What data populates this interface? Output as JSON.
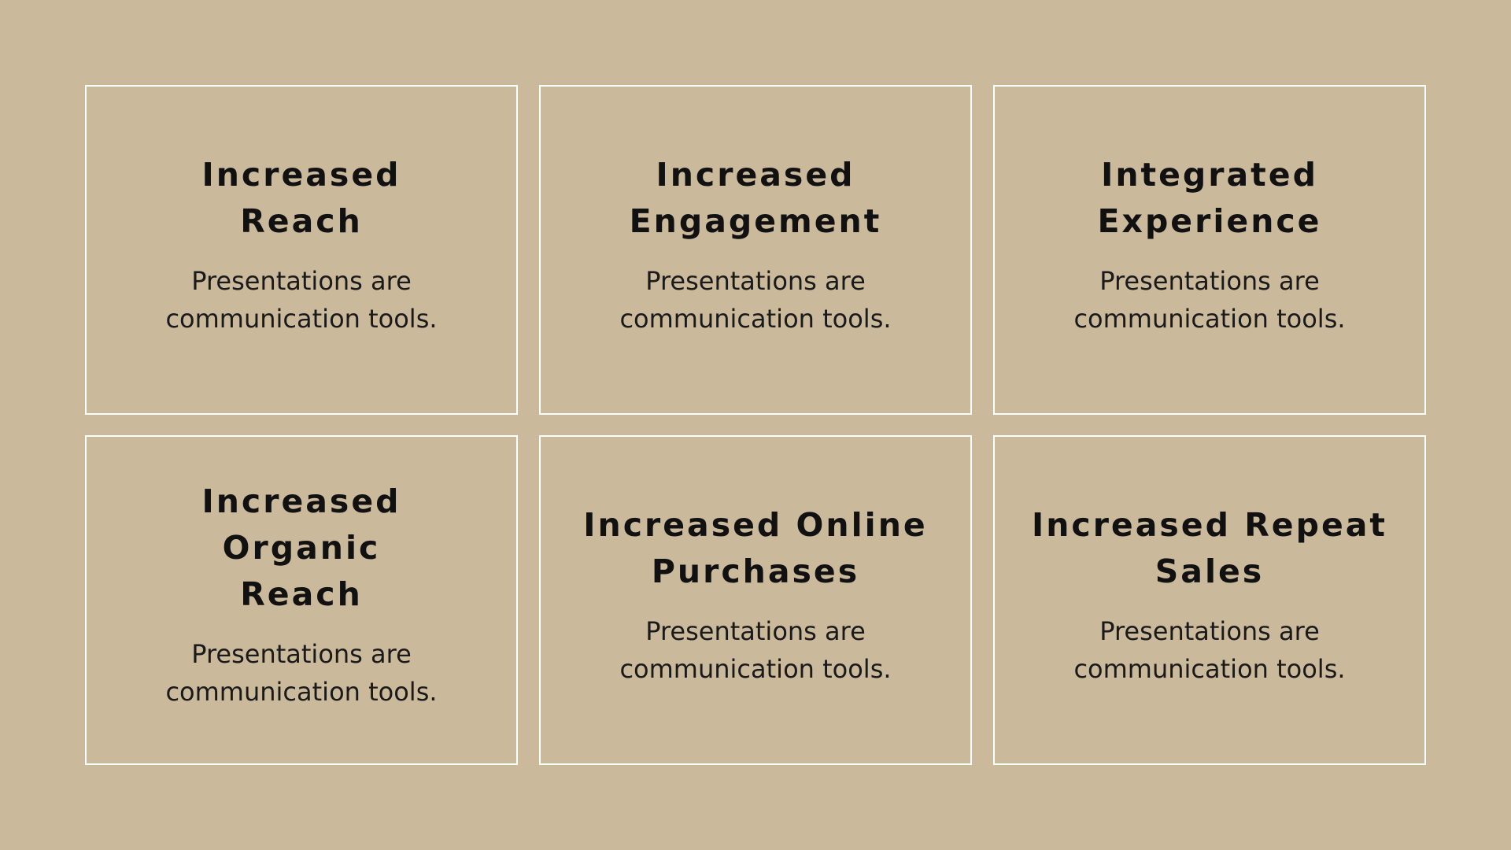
{
  "colors": {
    "background": "#CBB99C",
    "card_border": "#FFFFFF",
    "text": "#111111"
  },
  "cards": [
    {
      "title": "Increased\nReach",
      "text": "Presentations are\ncommunication tools."
    },
    {
      "title": "Increased\nEngagement",
      "text": "Presentations are\ncommunication tools."
    },
    {
      "title": "Integrated\nExperience",
      "text": "Presentations are\ncommunication tools."
    },
    {
      "title": "Increased Organic\nReach",
      "text": "Presentations are\ncommunication tools."
    },
    {
      "title": "Increased Online\nPurchases",
      "text": "Presentations are\ncommunication tools."
    },
    {
      "title": "Increased Repeat\nSales",
      "text": "Presentations are\ncommunication tools."
    }
  ]
}
